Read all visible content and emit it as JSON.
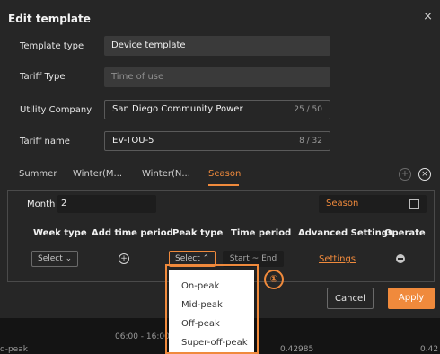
{
  "dialog": {
    "title": "Edit template",
    "close_icon": "×"
  },
  "form": {
    "template_type": {
      "label": "Template type",
      "value": "Device template"
    },
    "tariff_type": {
      "label": "Tariff Type",
      "value": "Time of use"
    },
    "utility_company": {
      "label": "Utility Company",
      "value": "San Diego Community Power",
      "count": "25 / 50"
    },
    "tariff_name": {
      "label": "Tariff name",
      "value": "EV-TOU-5",
      "count": "8 / 32"
    }
  },
  "tabs": [
    "Summer",
    "Winter(M...",
    "Winter(N...",
    "Season"
  ],
  "month": {
    "label": "Month",
    "value": "2",
    "season": "Season"
  },
  "table": {
    "headers": [
      "Week type",
      "Add time period",
      "Peak type",
      "Time period",
      "Advanced Settings",
      "Operate"
    ],
    "week_select": "Select",
    "peak_select": "Select",
    "time_start": "Start",
    "time_sep": "~",
    "time_end": "End",
    "settings_link": "Settings"
  },
  "dropdown": {
    "options": [
      "On-peak",
      "Mid-peak",
      "Off-peak",
      "Super-off-peak"
    ]
  },
  "buttons": {
    "cancel": "Cancel",
    "apply": "Apply"
  },
  "background": {
    "left_text": "d-peak",
    "time": "06:00 - 16:00",
    "value1": "0.42985",
    "value2": "0.42"
  },
  "callout": {
    "number": "①"
  },
  "colors": {
    "accent": "#f08a3c",
    "panel": "#262626"
  }
}
